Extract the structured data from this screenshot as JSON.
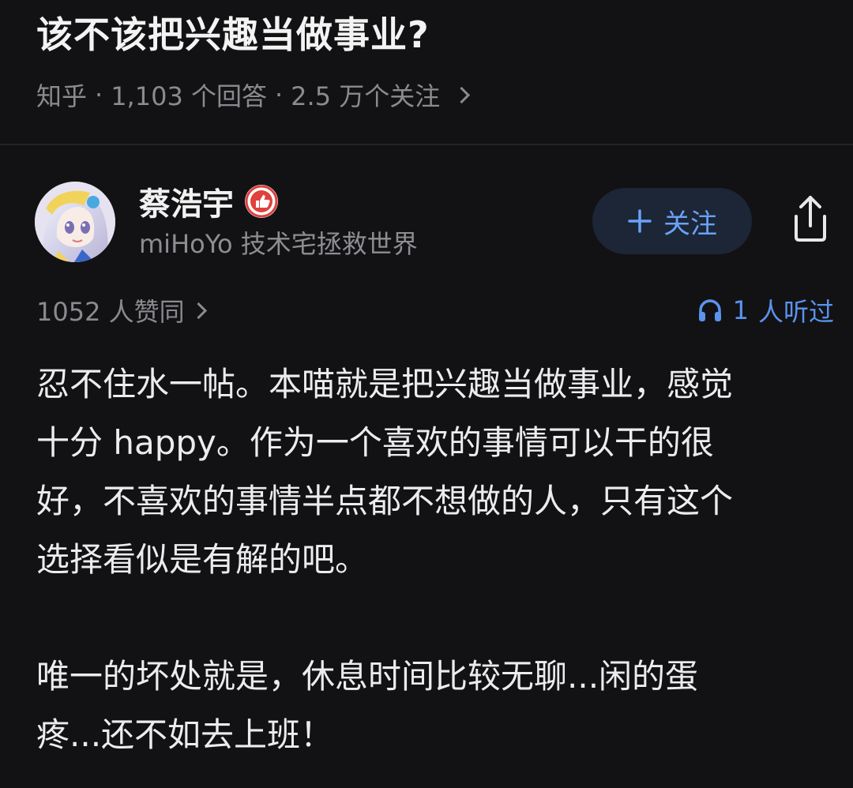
{
  "question": {
    "title": "该不该把兴趣当做事业?",
    "source": "知乎",
    "answers_count": "1,103 个回答",
    "followers_count": "2.5 万个关注"
  },
  "author": {
    "name": "蔡浩宇",
    "bio": "miHoYo 技术宅拯救世界",
    "badge_icon": "thumbs-up-badge-icon"
  },
  "actions": {
    "follow_label": "关注",
    "share_icon": "share-icon"
  },
  "stats": {
    "likes_label": "1052 人赞同",
    "listen_count": "1",
    "listen_suffix": "人听过"
  },
  "answer": {
    "lines": [
      "忍不住水一帖。本喵就是把兴趣当做事业，感觉",
      "十分 happy。作为一个喜欢的事情可以干的很",
      "好，不喜欢的事情半点都不想做的人，只有这个",
      "选择看似是有解的吧。",
      "唯一的坏处就是，休息时间比较无聊...闲的蛋",
      "疼...还不如去上班！"
    ]
  },
  "colors": {
    "background": "#121214",
    "accent_blue": "#5b93ee",
    "follow_bg": "#1c2637",
    "muted_text": "#8a8a8f",
    "badge_red": "#e0413b"
  }
}
